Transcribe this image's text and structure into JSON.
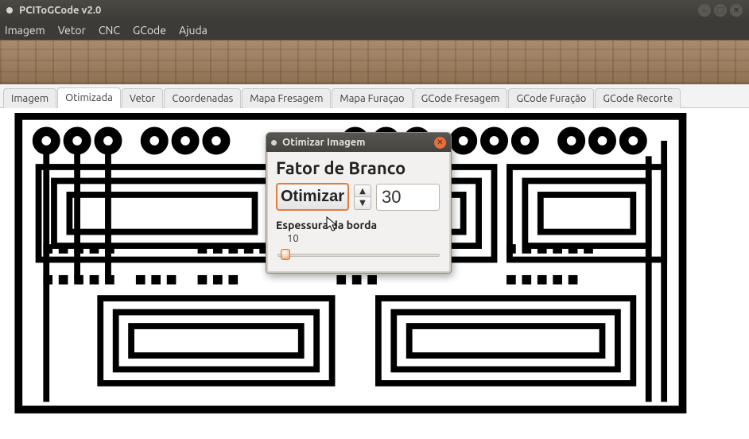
{
  "window": {
    "title": "PCIToGCode  v2.0"
  },
  "menu": {
    "items": [
      "Imagem",
      "Vetor",
      "CNC",
      "GCode",
      "Ajuda"
    ]
  },
  "tabs": {
    "items": [
      "Imagem",
      "Otimizada",
      "Vetor",
      "Coordenadas",
      "Mapa Fresagem",
      "Mapa Furaçao",
      "GCode Fresagem",
      "GCode Furação",
      "GCode Recorte"
    ],
    "active_index": 1
  },
  "dialog": {
    "title": "Otimizar Imagem",
    "heading": "Fator de Branco",
    "optimize_label": "Otimizar",
    "factor_value": "30",
    "border_label": "Espessura da borda",
    "border_value": "10"
  }
}
